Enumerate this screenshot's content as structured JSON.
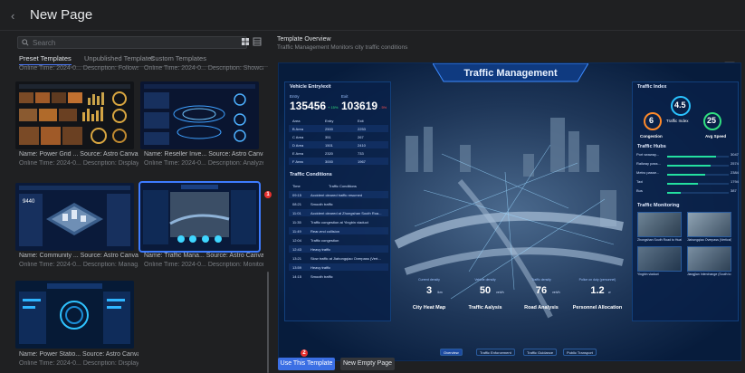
{
  "header": {
    "back_icon": "chevron-left-icon",
    "title": "New Page"
  },
  "search": {
    "placeholder": "Search"
  },
  "tabs": [
    {
      "label": "Preset Templates",
      "active": true
    },
    {
      "label": "Unpublished Templates",
      "active": false
    },
    {
      "label": "Custom Templates",
      "active": false
    }
  ],
  "cards": [
    {
      "name": "",
      "meta": "Online Time: 2024-0...  Description: Follows..."
    },
    {
      "name": "",
      "meta": "Online Time: 2024-0...  Description: Showca..."
    },
    {
      "name": "Name: Power Grid ...  Source: Astro Canvas",
      "meta": "Online Time: 2024-0...  Description: Display..."
    },
    {
      "name": "Name: Reseller Inve...  Source: Astro Canvas",
      "meta": "Online Time: 2024-0...  Description: Analyze..."
    },
    {
      "name": "Name: Community ...  Source: Astro Canvas",
      "meta": "Online Time: 2024-0...  Description: Manag..."
    },
    {
      "name": "Name: Traffic Mana...  Source: Astro Canvas",
      "meta": "Online Time: 2024-0...  Description: Monitor..."
    },
    {
      "name": "Name: Power Statio...  Source: Astro Canvas",
      "meta": "Online Time: 2024-0...  Description: Display..."
    }
  ],
  "badges": {
    "first": "1",
    "second": "2"
  },
  "overview": {
    "title": "Template Overview",
    "subtitle": "Traffic Management   Monitors city traffic conditions"
  },
  "preview": {
    "title": "Traffic Management",
    "vehicle": {
      "title": "Vehicle Entry/exit",
      "entry_label": "Entry",
      "entry_value": "135456",
      "entry_change": "+ 15%",
      "exit_label": "Exit",
      "exit_value": "103619",
      "exit_change": "- 5%",
      "columns": [
        "Area",
        "Entry",
        "Exit"
      ],
      "rows": [
        [
          "B Area",
          "2500",
          "2253"
        ],
        [
          "C Area",
          "351",
          "267"
        ],
        [
          "D Area",
          "1501",
          "2410"
        ],
        [
          "E Area",
          "2320",
          "733"
        ],
        [
          "F Area",
          "3000",
          "1967"
        ]
      ]
    },
    "conditions": {
      "title": "Traffic Conditions",
      "columns": [
        "Time",
        "Traffic Conditions"
      ],
      "rows": [
        [
          "09:15",
          "Accident cleared traffic resumed"
        ],
        [
          "08:21",
          "Smooth traffic"
        ],
        [
          "11:01",
          "Accident cleared at Zhongshan South Roa..."
        ],
        [
          "11:35",
          "Traffic congestion at Yingbin viaduct"
        ],
        [
          "11:49",
          "Rear-end collision"
        ],
        [
          "12:04",
          "Traffic congestion"
        ],
        [
          "12:43",
          "Heavy traffic"
        ],
        [
          "13:21",
          "Slow traffic at Jiahongqiao Overpass (Vert..."
        ],
        [
          "13:59",
          "Heavy traffic"
        ],
        [
          "14:15",
          "Smooth traffic"
        ]
      ]
    },
    "index": {
      "title": "Traffic Index",
      "main_value": "4.5",
      "main_label": "Traffic Index",
      "congestion_value": "6",
      "congestion_label": "Congestion",
      "speed_value": "25",
      "speed_label": "Avg Speed"
    },
    "hubs": {
      "title": "Traffic Hubs",
      "items": [
        {
          "label": "Port seaway...",
          "value": "3047",
          "fill": 0.8
        },
        {
          "label": "Railway pass...",
          "value": "2574",
          "fill": 0.7
        },
        {
          "label": "Metro passe...",
          "value": "2384",
          "fill": 0.62
        },
        {
          "label": "Taxi",
          "value": "1794",
          "fill": 0.5
        },
        {
          "label": "Bus",
          "value": "387",
          "fill": 0.22
        }
      ]
    },
    "monitoring": {
      "title": "Traffic Monitoring",
      "captions": [
        "Zhongshan South Road to Huaihai North Road",
        "Jiahongqiao Overpass (Vertical)",
        "Yingbin viaduct",
        "Jiangjian Interchange (South to north)"
      ]
    },
    "bottom_kpis": [
      {
        "caption": "Current density",
        "value": "3",
        "unit": "/km",
        "label": "City Heat Map"
      },
      {
        "caption": "Vehicle density",
        "value": "50",
        "unit": "veh/h",
        "label": "Traffic Aalysis"
      },
      {
        "caption": "Traffic density",
        "value": "76",
        "unit": "veh/h",
        "label": "Road Analysis"
      },
      {
        "caption": "Police on duty (personnel)",
        "value": "1.2",
        "unit": "w",
        "label": "Personnel Allocation"
      }
    ],
    "tabs": [
      {
        "label": "Overview",
        "active": true
      },
      {
        "label": "Traffic Enforcement",
        "active": false
      },
      {
        "label": "Traffic Guidance",
        "active": false
      },
      {
        "label": "Public Transport",
        "active": false
      }
    ]
  },
  "actions": {
    "use_label": "Use This Template",
    "empty_label": "New Empty Page"
  },
  "colors": {
    "accent": "#3b6fe4",
    "selected": "#3d7bff",
    "badge": "#e8312f"
  }
}
